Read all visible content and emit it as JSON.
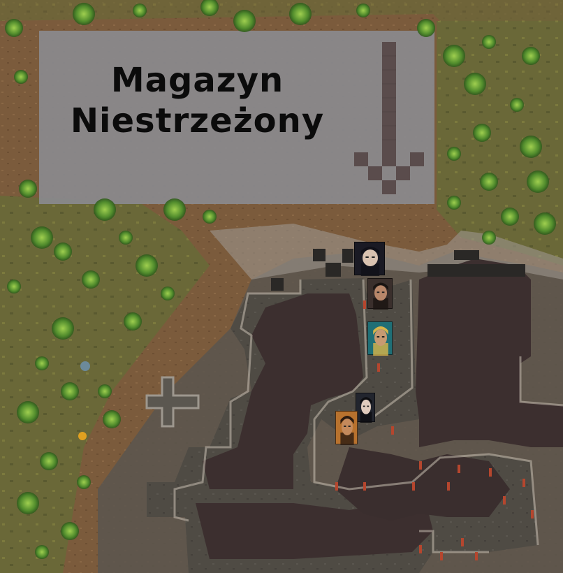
{
  "zone": {
    "title_line1": "Magazyn",
    "title_line2": "Niestrzeżony"
  },
  "colonists": [
    {
      "name_icon": "colonist-portrait-dark-hair-woman",
      "bg": "#1a1a24",
      "skin": "#d9c2b0",
      "hair": "#101018"
    },
    {
      "name_icon": "colonist-portrait-sunglasses-man",
      "bg": "#3a2f2c",
      "skin": "#b9876a",
      "hair": "#1a1412"
    },
    {
      "name_icon": "colonist-portrait-feather-headdress",
      "bg": "#1f6f76",
      "skin": "#c79a72",
      "hair": "#d8b44a"
    },
    {
      "name_icon": "colonist-portrait-suit-man",
      "bg": "#22252e",
      "skin": "#e0cbbd",
      "hair": "#0d0d10"
    },
    {
      "name_icon": "colonist-portrait-bearded-captain",
      "bg": "#b8722e",
      "skin": "#c48a5c",
      "hair": "#2a1a10"
    }
  ],
  "colors": {
    "soil": "#7a5a3a",
    "grass": "#6f6a3a",
    "zone_fill": "#8a8a8e",
    "rock_floor": "#4e4b45",
    "cave_dark": "#3a2e2e",
    "smooth_wall": "#2c2a28",
    "arrow": "#5a4c4c"
  }
}
